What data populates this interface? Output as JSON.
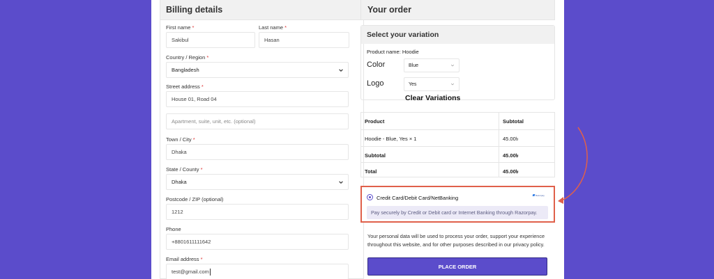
{
  "billing": {
    "title": "Billing details",
    "first_name": {
      "label": "First name",
      "required": "*",
      "value": "Sakibul"
    },
    "last_name": {
      "label": "Last name",
      "required": "*",
      "value": "Hasan"
    },
    "country": {
      "label": "Country / Region",
      "required": "*",
      "value": "Bangladesh"
    },
    "street": {
      "label": "Street address",
      "required": "*",
      "value": "House 01, Road 04",
      "placeholder2": "Apartment, suite, unit, etc. (optional)"
    },
    "town": {
      "label": "Town / City",
      "required": "*",
      "value": "Dhaka"
    },
    "state": {
      "label": "State / County",
      "required": "*",
      "value": "Dhaka"
    },
    "postcode": {
      "label": "Postcode / ZIP (optional)",
      "value": "1212"
    },
    "phone": {
      "label": "Phone",
      "value": "+8801611111642"
    },
    "email": {
      "label": "Email address",
      "required": "*",
      "value": "test@gmail.com"
    }
  },
  "order": {
    "title": "Your order",
    "variation": {
      "title": "Select your variation",
      "product_name": "Product name: Hoodie",
      "color_label": "Color",
      "color_value": "Blue",
      "logo_label": "Logo",
      "logo_value": "Yes",
      "clear_label": "Clear Variations"
    },
    "table": {
      "head_product": "Product",
      "head_subtotal": "Subtotal",
      "item_name": "Hoodie - Blue, Yes",
      "item_qty": "× 1",
      "item_price": "45.00৳",
      "subtotal_label": "Subtotal",
      "subtotal_value": "45.00৳",
      "total_label": "Total",
      "total_value": "45.00৳"
    },
    "payment": {
      "method_label": "Credit Card/Debit Card/NetBanking",
      "logo_text": "Razorpay",
      "description": "Pay securely by Credit or Debit card or Internet Banking through Razorpay."
    },
    "privacy_text": "Your personal data will be used to process your order, support your experience throughout this website, and for other purposes described in our privacy policy.",
    "place_order_label": "PLACE ORDER"
  },
  "colors": {
    "background": "#5b4ccb",
    "accent": "#5b4ccb",
    "highlight": "#e0604a"
  }
}
